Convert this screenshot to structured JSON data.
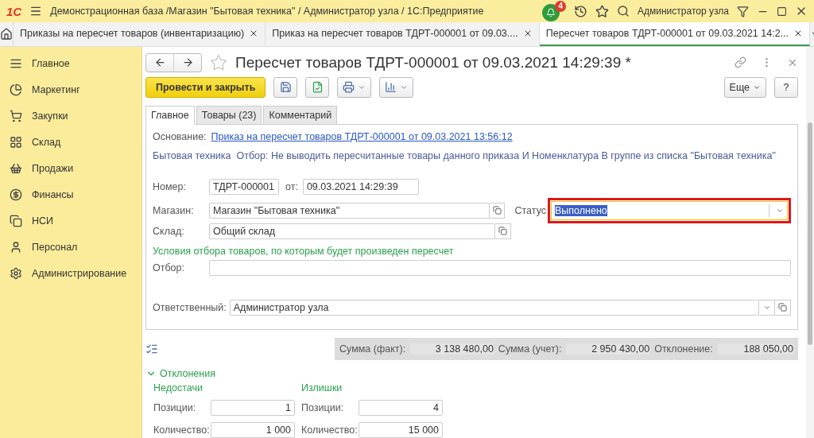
{
  "window": {
    "logo": "1С",
    "title": "Демонстрационная база /Магазин \"Бытовая техника\" / Администратор узла / 1С:Предприятие",
    "notifications": "4",
    "user": "Администратор узла"
  },
  "tabs": [
    {
      "label": "Приказы на пересчет товаров (инвентаризацию)",
      "selected": false
    },
    {
      "label": "Приказ на пересчет товаров ТДРТ-000001 от 09.03....",
      "selected": false
    },
    {
      "label": "Пересчет товаров ТДРТ-000001 от 09.03.2021 14:2...",
      "selected": true
    }
  ],
  "sidebar": {
    "items": [
      {
        "label": "Главное"
      },
      {
        "label": "Маркетинг"
      },
      {
        "label": "Закупки"
      },
      {
        "label": "Склад"
      },
      {
        "label": "Продажи"
      },
      {
        "label": "Финансы"
      },
      {
        "label": "НСИ"
      },
      {
        "label": "Персонал"
      },
      {
        "label": "Администрирование"
      }
    ]
  },
  "form": {
    "title": "Пересчет товаров ТДРТ-000001 от 09.03.2021 14:29:39 *",
    "starred": false,
    "post_button": "Провести и закрыть",
    "more_button": "Еще",
    "help_button": "?",
    "tabs": [
      {
        "label": "Главное",
        "selected": true
      },
      {
        "label": "Товары (23)",
        "selected": false
      },
      {
        "label": "Комментарий",
        "selected": false
      }
    ],
    "basis_label": "Основание:",
    "basis_link": "Приказ на пересчет товаров ТДРТ-000001 от 09.03.2021 13:56:12",
    "filter_info": "Бытовая техника  Отбор: Не выводить пересчитанные товары данного приказа И Номенклатура В группе из списка \"Бытовая техника\"",
    "number_label": "Номер:",
    "number": "ТДРТ-000001",
    "date_label": "от:",
    "date": "09.03.2021 14:29:39",
    "store_label": "Магазин:",
    "store": "Магазин \"Бытовая техника\"",
    "status_label": "Статус",
    "status": "Выполнено",
    "status_outlined": true,
    "status_text_selected": true,
    "warehouse_label": "Склад:",
    "warehouse": "Общий склад",
    "conditions_caption": "Условия отбора товаров, по которым будет произведен пересчет",
    "filter_label": "Отбор:",
    "responsible_label": "Ответственный:",
    "responsible": "Администратор узла"
  },
  "totals": [
    {
      "label": "Сумма (факт):",
      "value": "3 138 480,00"
    },
    {
      "label": "Сумма (учет):",
      "value": "2 950 430,00"
    },
    {
      "label": "Отклонение:",
      "value": "188 050,00"
    }
  ],
  "deviations": {
    "title": "Отклонения",
    "expanded": true,
    "groups": [
      {
        "title": "Недостачи",
        "rows": [
          {
            "label": "Позиции:",
            "value": "1"
          },
          {
            "label": "Количество:",
            "value": "1 000"
          }
        ]
      },
      {
        "title": "Излишки",
        "rows": [
          {
            "label": "Позиции:",
            "value": "4"
          },
          {
            "label": "Количество:",
            "value": "15 000"
          }
        ]
      }
    ]
  }
}
